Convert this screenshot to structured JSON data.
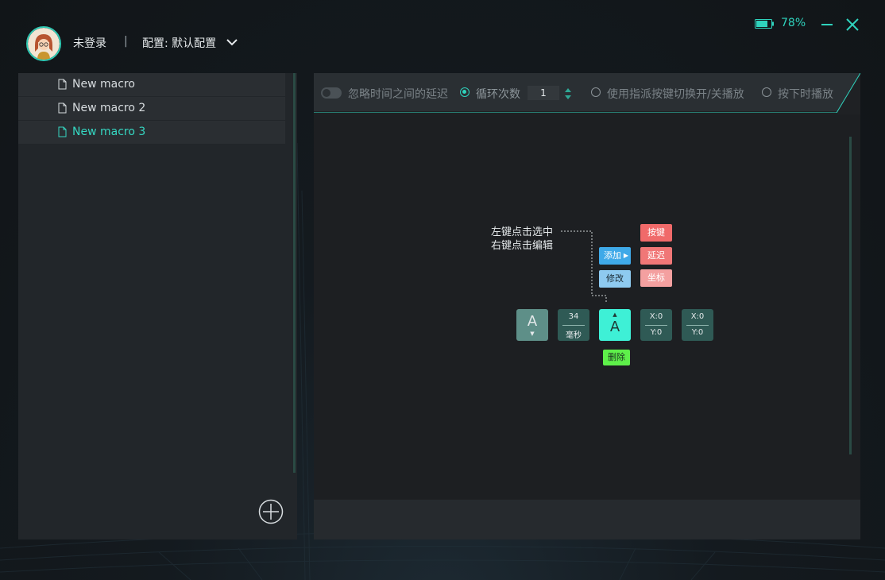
{
  "header": {
    "login_status": "未登录",
    "separator": "|",
    "profile_label": "配置: 默认配置",
    "battery_percent": "78%",
    "battery_level": 0.78
  },
  "sidebar": {
    "macros": [
      {
        "label": "New macro",
        "active": false
      },
      {
        "label": "New macro 2",
        "active": false
      },
      {
        "label": "New macro 3",
        "active": true
      }
    ]
  },
  "toolbar": {
    "ignore_delay_label": "忽略时间之间的延迟",
    "loop_label": "循环次数",
    "loop_count": "1",
    "toggle_assigned_label": "使用指派按键切换开/关播放",
    "hold_play_label": "按下时播放"
  },
  "hint": {
    "line1": "左键点击选中",
    "line2": "右键点击编辑"
  },
  "menu": {
    "add_label": "添加",
    "modify_label": "修改",
    "key_label": "按键",
    "delay_label": "延迟",
    "coord_label": "坐标",
    "delete_label": "删除"
  },
  "nodes": {
    "key_down": "A",
    "delay_value": "34",
    "delay_unit": "毫秒",
    "key_up": "A",
    "coord1_x": "X:0",
    "coord1_y": "Y:0",
    "coord2_x": "X:0",
    "coord2_y": "Y:0"
  },
  "colors": {
    "accent": "#2fd3bd",
    "key_btn": "#f06a6a",
    "delay_btn": "#f07777",
    "coord_btn": "#f4a0a0",
    "add_btn": "#3fa9e8",
    "modify_btn": "#8ecaf0",
    "delete_btn": "#5ef04a",
    "node_key_down": "#5e8f88",
    "node_dark": "#2f5a55",
    "node_selected": "#3ef0d6"
  }
}
